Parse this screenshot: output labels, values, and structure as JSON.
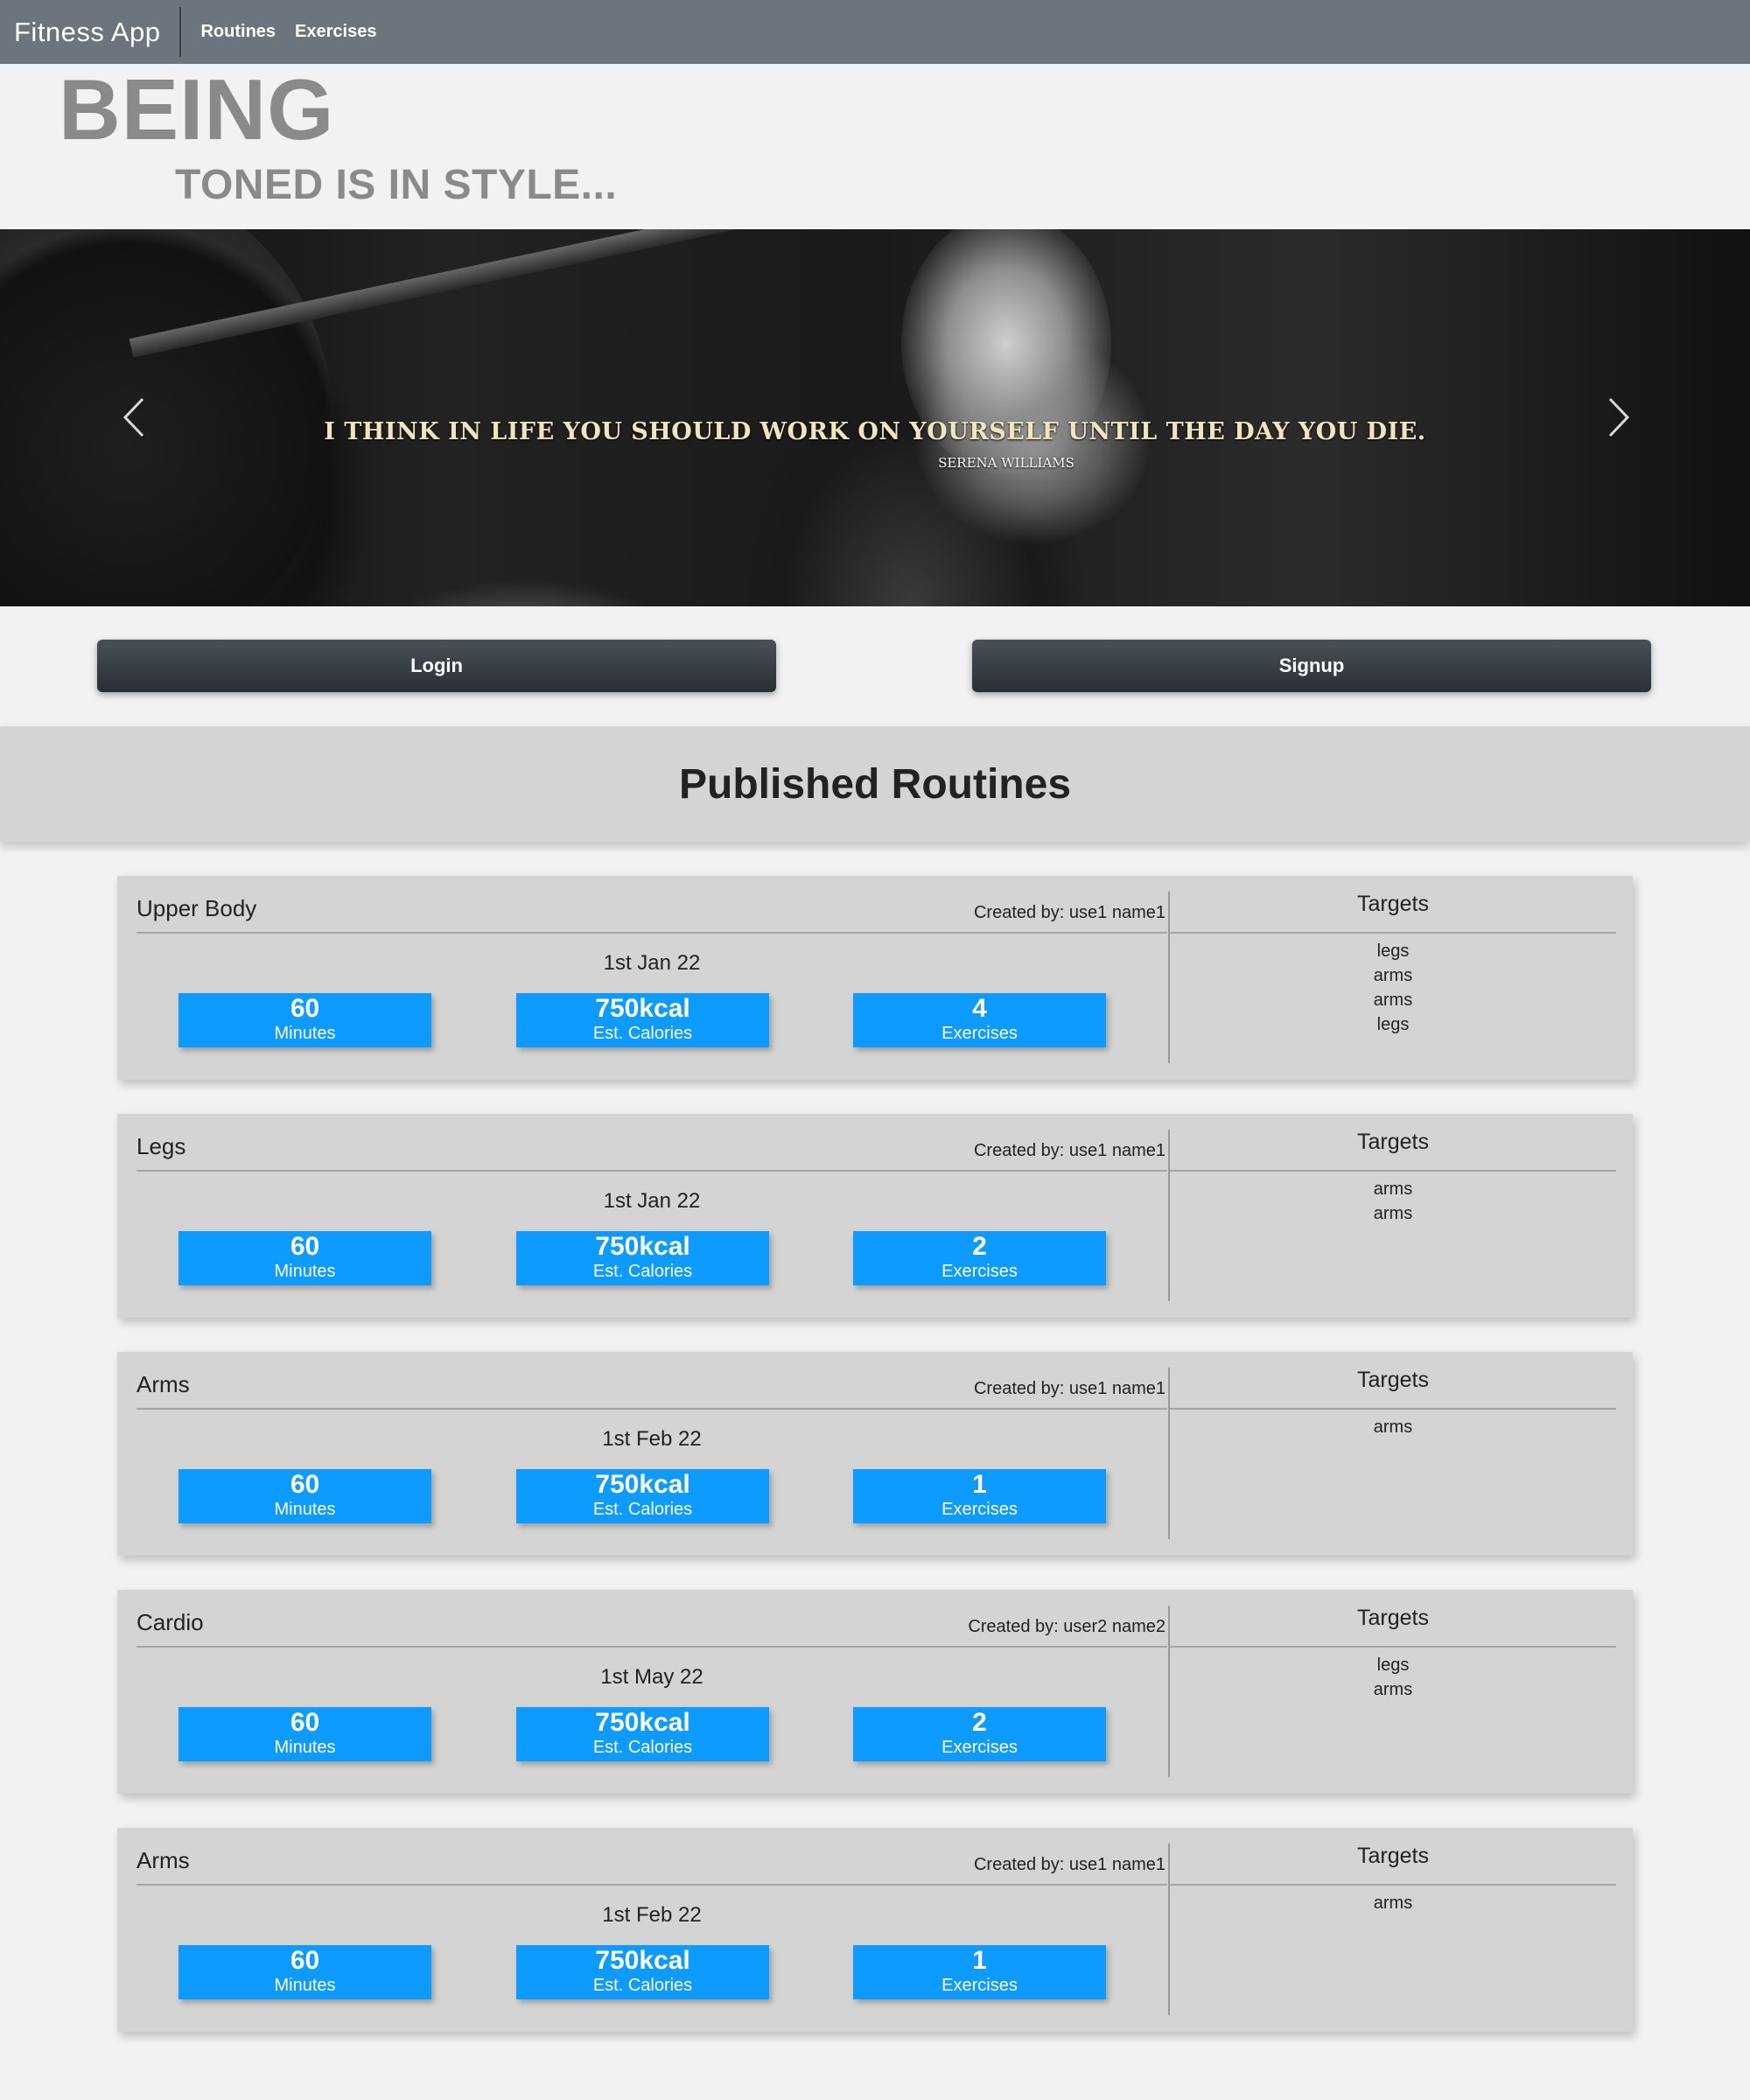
{
  "navbar": {
    "brand": "Fitness App",
    "links": [
      "Routines",
      "Exercises"
    ]
  },
  "hero": {
    "headline": "BEING",
    "subheadline": "TONED IS IN STYLE...",
    "quote": "I THINK IN LIFE YOU SHOULD WORK ON YOURSELF UNTIL THE DAY YOU DIE.",
    "author": "SERENA WILLIAMS"
  },
  "auth": {
    "login_label": "Login",
    "signup_label": "Signup"
  },
  "routines_section": {
    "title": "Published Routines",
    "targets_header": "Targets",
    "routines": [
      {
        "name": "Upper Body",
        "creator": "Created by: use1 name1",
        "date": "1st Jan 22",
        "stats": [
          {
            "value": "60",
            "label": "Minutes"
          },
          {
            "value": "750kcal",
            "label": "Est. Calories"
          },
          {
            "value": "4",
            "label": "Exercises"
          }
        ],
        "targets": [
          "legs",
          "arms",
          "arms",
          "legs"
        ]
      },
      {
        "name": "Legs",
        "creator": "Created by: use1 name1",
        "date": "1st Jan 22",
        "stats": [
          {
            "value": "60",
            "label": "Minutes"
          },
          {
            "value": "750kcal",
            "label": "Est. Calories"
          },
          {
            "value": "2",
            "label": "Exercises"
          }
        ],
        "targets": [
          "arms",
          "arms"
        ]
      },
      {
        "name": "Arms",
        "creator": "Created by: use1 name1",
        "date": "1st Feb 22",
        "stats": [
          {
            "value": "60",
            "label": "Minutes"
          },
          {
            "value": "750kcal",
            "label": "Est. Calories"
          },
          {
            "value": "1",
            "label": "Exercises"
          }
        ],
        "targets": [
          "arms"
        ]
      },
      {
        "name": "Cardio",
        "creator": "Created by: user2 name2",
        "date": "1st May 22",
        "stats": [
          {
            "value": "60",
            "label": "Minutes"
          },
          {
            "value": "750kcal",
            "label": "Est. Calories"
          },
          {
            "value": "2",
            "label": "Exercises"
          }
        ],
        "targets": [
          "legs",
          "arms"
        ]
      },
      {
        "name": "Arms",
        "creator": "Created by: use1 name1",
        "date": "1st Feb 22",
        "stats": [
          {
            "value": "60",
            "label": "Minutes"
          },
          {
            "value": "750kcal",
            "label": "Est. Calories"
          },
          {
            "value": "1",
            "label": "Exercises"
          }
        ],
        "targets": [
          "arms"
        ]
      }
    ]
  },
  "colors": {
    "navbar": "#6c757d",
    "stat_badge": "#0d9bff",
    "button": "#343a40",
    "card": "#d4d4d4",
    "page": "#f2f2f2"
  },
  "icons": {
    "carousel_prev": "chevron-left-icon",
    "carousel_next": "chevron-right-icon"
  }
}
